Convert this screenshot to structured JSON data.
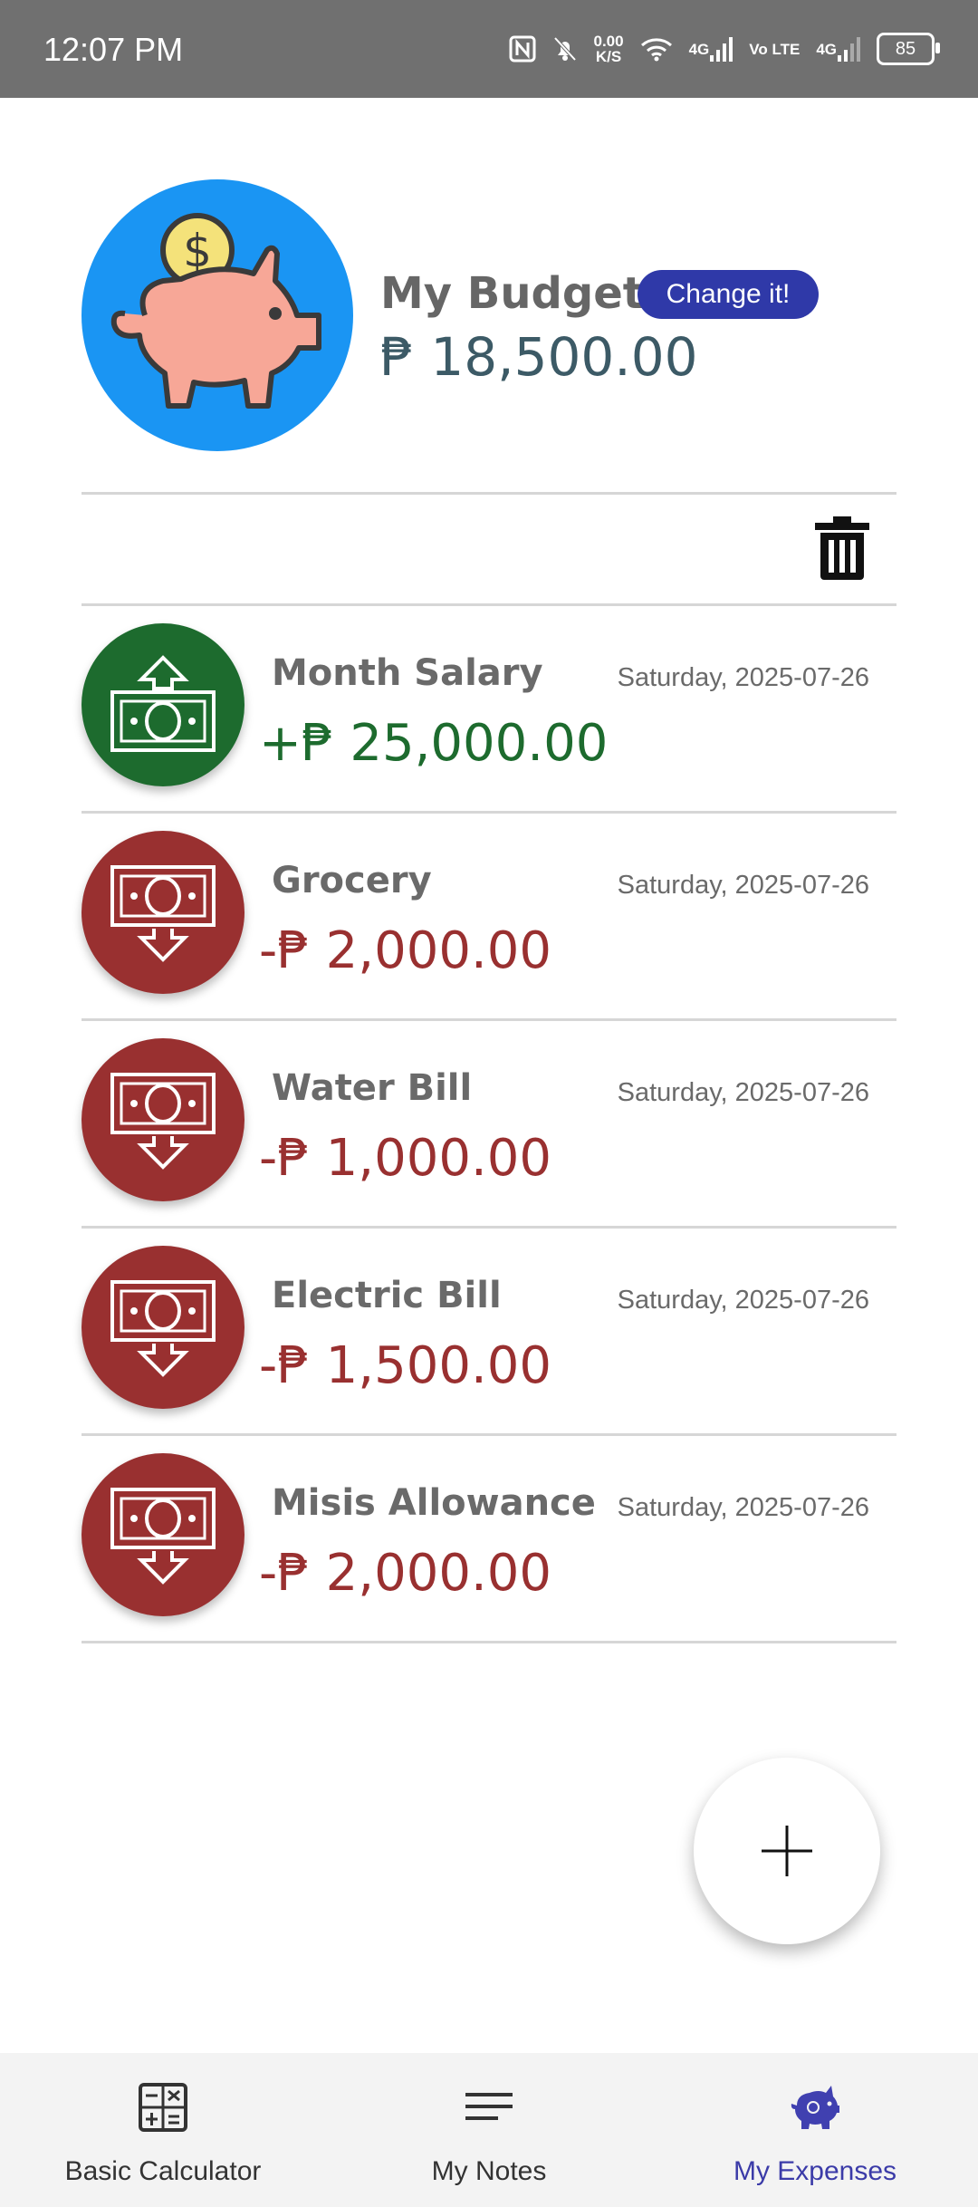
{
  "status_bar": {
    "time": "12:07 PM",
    "net_speed_value": "0.00",
    "net_speed_unit": "K/S",
    "sim1_label": "4G",
    "volte_label": "Vo LTE",
    "sim2_label": "4G",
    "battery_level": "85"
  },
  "budget": {
    "title": "My Budget",
    "change_label": "Change it!",
    "amount": "₱ 18,500.00"
  },
  "transactions": [
    {
      "name": "Month Salary",
      "date": "Saturday, 2025-07-26",
      "amount": "+₱ 25,000.00",
      "type": "income",
      "icon": "money-up-icon"
    },
    {
      "name": "Grocery",
      "date": "Saturday, 2025-07-26",
      "amount": "-₱ 2,000.00",
      "type": "expense",
      "icon": "money-down-icon"
    },
    {
      "name": "Water Bill",
      "date": "Saturday, 2025-07-26",
      "amount": "-₱ 1,000.00",
      "type": "expense",
      "icon": "money-down-icon"
    },
    {
      "name": "Electric Bill",
      "date": "Saturday, 2025-07-26",
      "amount": "-₱ 1,500.00",
      "type": "expense",
      "icon": "money-down-icon"
    },
    {
      "name": "Misis Allowance",
      "date": "Saturday, 2025-07-26",
      "amount": "-₱ 2,000.00",
      "type": "expense",
      "icon": "money-down-icon"
    }
  ],
  "bottom_nav": {
    "items": [
      {
        "label": "Basic Calculator",
        "icon": "calculator-icon",
        "active": false
      },
      {
        "label": "My Notes",
        "icon": "notes-icon",
        "active": false
      },
      {
        "label": "My Expenses",
        "icon": "piggy-bank-icon",
        "active": true
      }
    ]
  },
  "colors": {
    "income": "#1d6b2e",
    "expense": "#993030",
    "accent": "#2f39a8",
    "avatar_bg": "#1a95f3"
  }
}
